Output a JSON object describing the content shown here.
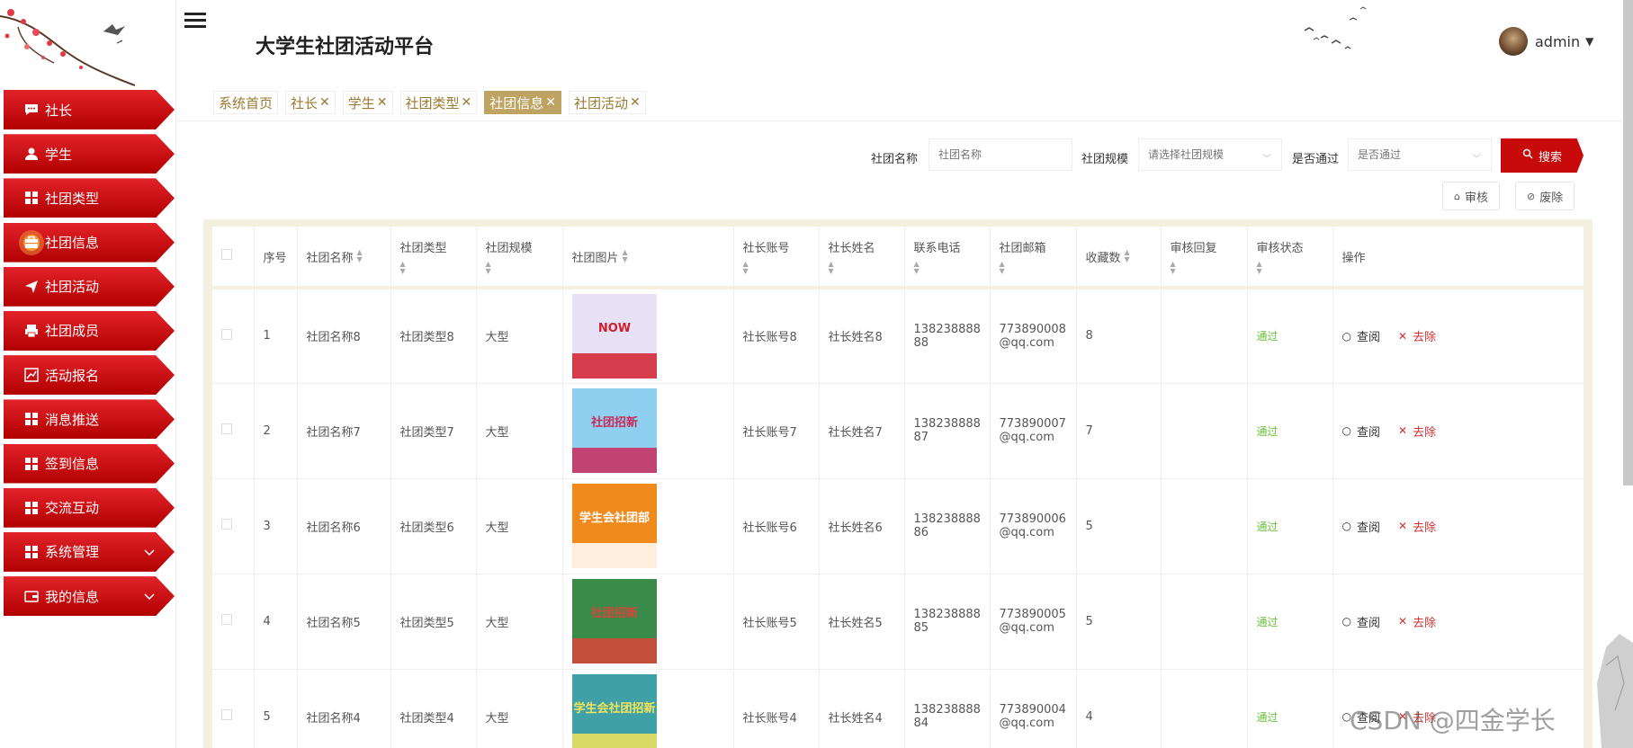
{
  "header": {
    "title": "大学生社团活动平台",
    "username": "admin"
  },
  "sidebar": {
    "items": [
      {
        "label": "社长",
        "icon": "chat-icon"
      },
      {
        "label": "学生",
        "icon": "user-icon"
      },
      {
        "label": "社团类型",
        "icon": "grid-icon"
      },
      {
        "label": "社团信息",
        "icon": "briefcase-icon",
        "active": true
      },
      {
        "label": "社团活动",
        "icon": "send-icon"
      },
      {
        "label": "社团成员",
        "icon": "printer-icon"
      },
      {
        "label": "活动报名",
        "icon": "chart-icon"
      },
      {
        "label": "消息推送",
        "icon": "grid-icon"
      },
      {
        "label": "签到信息",
        "icon": "grid-icon"
      },
      {
        "label": "交流互动",
        "icon": "grid-icon"
      },
      {
        "label": "系统管理",
        "icon": "grid-icon",
        "expandable": true
      },
      {
        "label": "我的信息",
        "icon": "wallet-icon",
        "expandable": true
      }
    ]
  },
  "tabs": [
    {
      "label": "系统首页",
      "closable": false
    },
    {
      "label": "社长",
      "closable": true
    },
    {
      "label": "学生",
      "closable": true
    },
    {
      "label": "社团类型",
      "closable": true
    },
    {
      "label": "社团信息",
      "closable": true,
      "active": true
    },
    {
      "label": "社团活动",
      "closable": true
    }
  ],
  "tab_close_glyph": "✕",
  "search": {
    "name_label": "社团名称",
    "name_placeholder": "社团名称",
    "scale_label": "社团规模",
    "scale_placeholder": "请选择社团规模",
    "pass_label": "是否通过",
    "pass_placeholder": "是否通过",
    "search_button": "搜索",
    "audit_button": "审核",
    "delete_button": "废除"
  },
  "table": {
    "headers": {
      "index": "序号",
      "name": "社团名称",
      "type": "社团类型",
      "scale": "社团规模",
      "image": "社团图片",
      "leader_account": "社长账号",
      "leader_name": "社长姓名",
      "phone": "联系电话",
      "email": "社团邮箱",
      "favorites": "收藏数",
      "reply": "审核回复",
      "status": "审核状态",
      "actions": "操作"
    },
    "view_label": "查阅",
    "delete_label": "去除",
    "rows": [
      {
        "index": "1",
        "name": "社团名称8",
        "type": "社团类型8",
        "scale": "大型",
        "leader_account": "社长账号8",
        "leader_name": "社长姓名8",
        "phone_1": "138238888",
        "phone_2": "88",
        "email_1": "773890008",
        "email_2": "@qq.com",
        "favorites": "8",
        "reply": "",
        "status": "通过",
        "img_text": "NOW",
        "img_color": "#e8e0f4",
        "img_accent": "#d11e2e"
      },
      {
        "index": "2",
        "name": "社团名称7",
        "type": "社团类型7",
        "scale": "大型",
        "leader_account": "社长账号7",
        "leader_name": "社长姓名7",
        "phone_1": "138238888",
        "phone_2": "87",
        "email_1": "773890007",
        "email_2": "@qq.com",
        "favorites": "7",
        "reply": "",
        "status": "通过",
        "img_text": "社团招新",
        "img_color": "#8fd0f0",
        "img_accent": "#c92a5a"
      },
      {
        "index": "3",
        "name": "社团名称6",
        "type": "社团类型6",
        "scale": "大型",
        "leader_account": "社长账号6",
        "leader_name": "社长姓名6",
        "phone_1": "138238888",
        "phone_2": "86",
        "email_1": "773890006",
        "email_2": "@qq.com",
        "favorites": "5",
        "reply": "",
        "status": "通过",
        "img_text": "学生会社团部",
        "img_color": "#f08a1c",
        "img_accent": "#ffffff"
      },
      {
        "index": "4",
        "name": "社团名称5",
        "type": "社团类型5",
        "scale": "大型",
        "leader_account": "社长账号5",
        "leader_name": "社长姓名5",
        "phone_1": "138238888",
        "phone_2": "85",
        "email_1": "773890005",
        "email_2": "@qq.com",
        "favorites": "5",
        "reply": "",
        "status": "通过",
        "img_text": "社团招新",
        "img_color": "#3a8a4a",
        "img_accent": "#d9443a"
      },
      {
        "index": "5",
        "name": "社团名称4",
        "type": "社团类型4",
        "scale": "大型",
        "leader_account": "社长账号4",
        "leader_name": "社长姓名4",
        "phone_1": "138238888",
        "phone_2": "84",
        "email_1": "773890004",
        "email_2": "@qq.com",
        "favorites": "4",
        "reply": "",
        "status": "通过",
        "img_text": "学生会社团招新",
        "img_color": "#3fa0a8",
        "img_accent": "#f2e45a"
      }
    ]
  },
  "watermark": "CSDN @四金学长"
}
